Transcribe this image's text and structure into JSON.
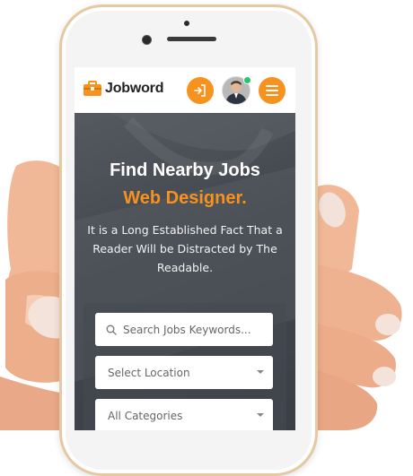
{
  "app": {
    "brand": "Jobword"
  },
  "hero": {
    "title": "Find Nearby Jobs",
    "subtitle": "Web Designer.",
    "description": "It is a Long Established Fact That a Reader Will be Distracted by The Readable."
  },
  "search": {
    "keywords_placeholder": "Search Jobs Keywords...",
    "location_value": "Select Location",
    "category_value": "All Categories"
  },
  "colors": {
    "accent": "#f7921e",
    "online": "#28c36a"
  },
  "icons": {
    "logo": "briefcase-icon",
    "login": "login-icon",
    "menu": "hamburger-icon",
    "search": "search-icon",
    "dropdown": "chevron-down-icon"
  }
}
